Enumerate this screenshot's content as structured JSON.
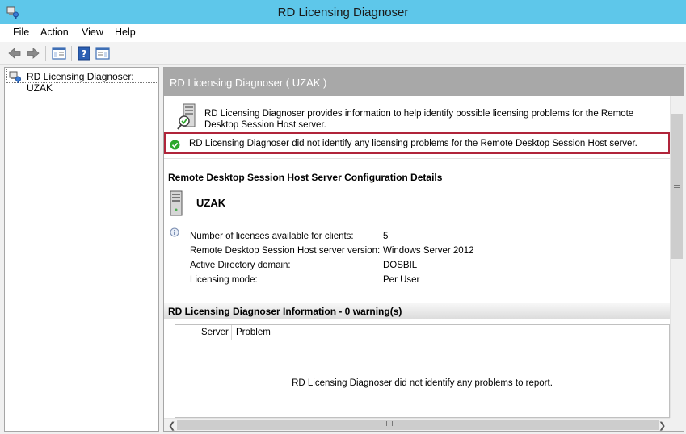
{
  "window": {
    "title": "RD Licensing Diagnoser"
  },
  "menu": {
    "file": "File",
    "action": "Action",
    "view": "View",
    "help": "Help"
  },
  "tree": {
    "root_label": "RD Licensing Diagnoser: UZAK"
  },
  "panel": {
    "header": "RD Licensing Diagnoser ( UZAK )",
    "intro": "RD Licensing Diagnoser provides information to help identify possible licensing problems for the Remote Desktop Session Host server.",
    "status": "RD Licensing Diagnoser did not identify any licensing problems for the Remote Desktop Session Host server."
  },
  "config": {
    "section_title": "Remote Desktop Session Host Server Configuration Details",
    "server_name": "UZAK",
    "rows": [
      {
        "label": "Number of licenses available for clients:",
        "value": "5"
      },
      {
        "label": "Remote Desktop Session Host server version:",
        "value": "Windows Server 2012"
      },
      {
        "label": "Active Directory domain:",
        "value": "DOSBIL"
      },
      {
        "label": "Licensing mode:",
        "value": "Per User"
      }
    ]
  },
  "info": {
    "title": "RD Licensing Diagnoser Information - 0 warning(s)",
    "columns": [
      "Server",
      "Problem"
    ],
    "empty_message": "RD Licensing Diagnoser did not identify any problems to report."
  },
  "colors": {
    "titlebar": "#5ec7ea",
    "header_band": "#a8a8a8",
    "status_border": "#b0243a",
    "ok_green": "#2ea82e"
  },
  "icons": {
    "app": "rd-licensing-icon",
    "back": "back-arrow-icon",
    "forward": "forward-arrow-icon",
    "show_hide_tree": "console-tree-icon",
    "help": "help-icon",
    "action_pane": "action-pane-icon",
    "server": "server-icon",
    "ok": "check-circle-icon",
    "info": "info-icon"
  }
}
